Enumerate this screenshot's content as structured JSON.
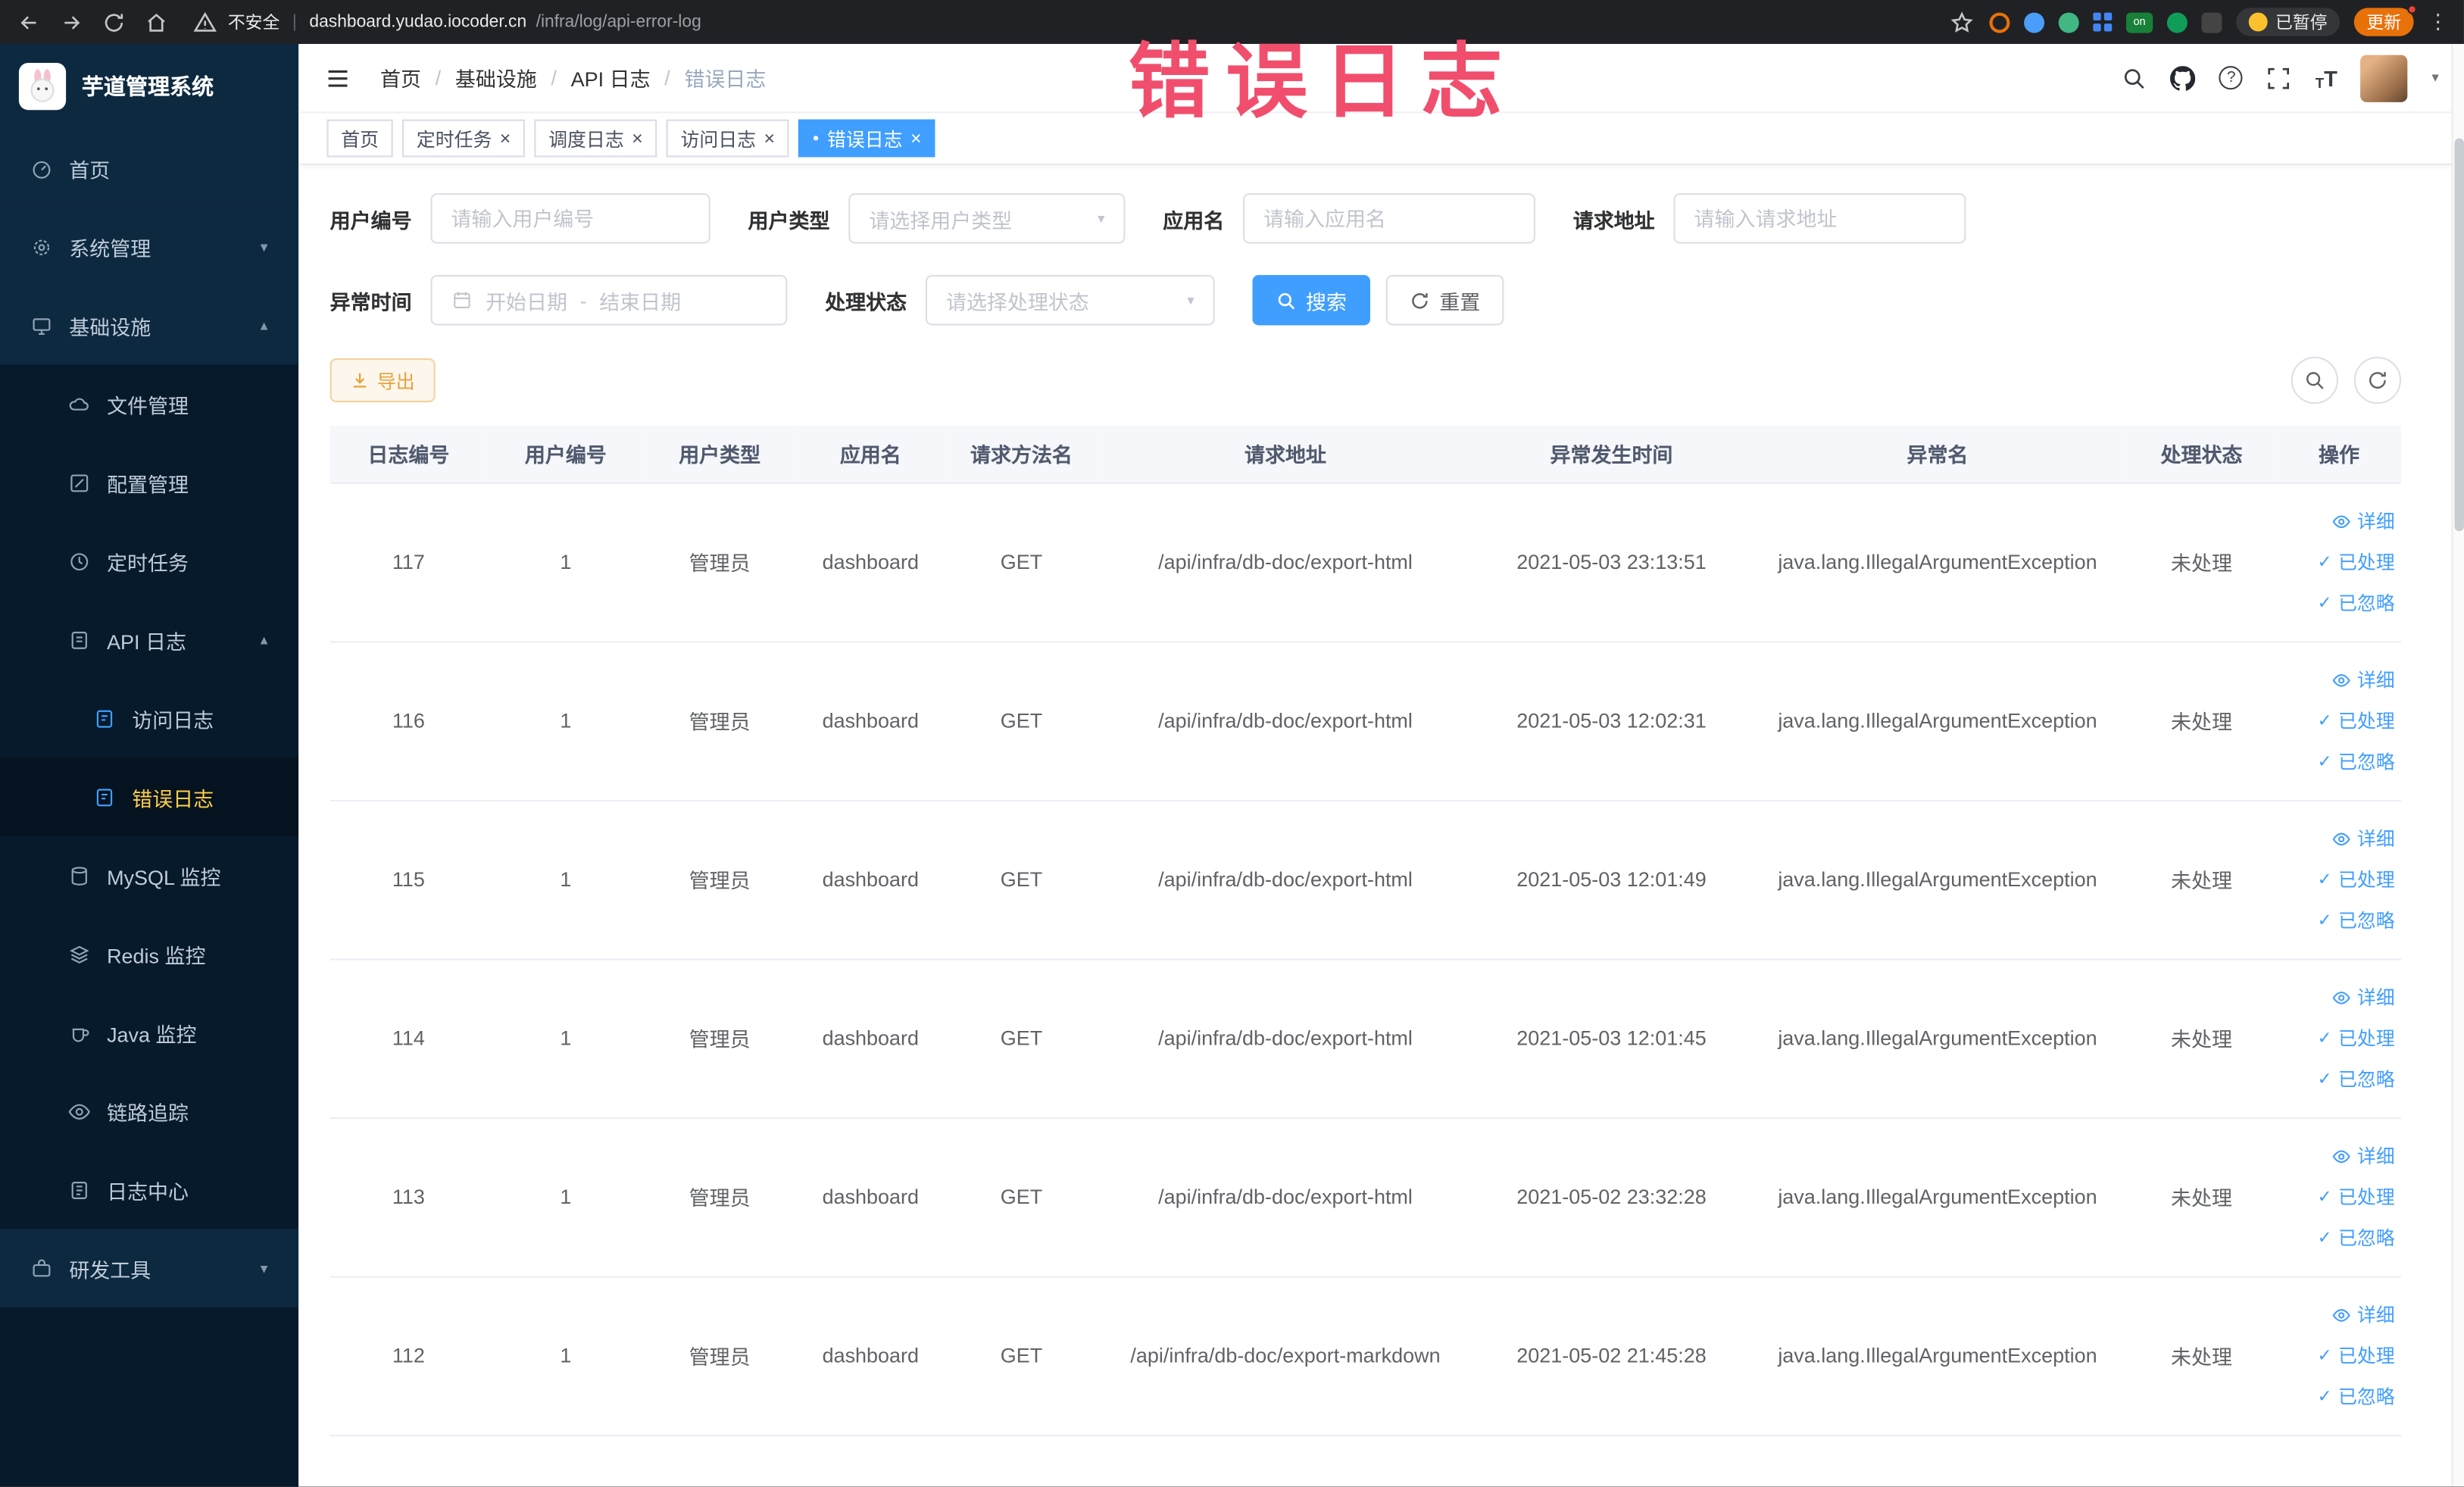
{
  "browser": {
    "security_label": "不安全",
    "url_host": "dashboard.yudao.iocoder.cn",
    "url_path": "/infra/log/api-error-log",
    "extension_on_label": "on",
    "paused_label": "已暂停",
    "update_label": "更新"
  },
  "annotation_text": "错误日志",
  "icons": {
    "check": "✓",
    "close": "×",
    "dot": "●",
    "chevron_down": "▼",
    "chevron_up": "▲",
    "caret_down": "▾",
    "kebab": "⋮",
    "slash": "/",
    "range_separator": "-",
    "question": "?",
    "font_size_large": "T",
    "font_size_small": "T"
  },
  "sidebar": {
    "title": "芋道管理系统",
    "items": [
      {
        "label": "首页"
      },
      {
        "label": "系统管理"
      },
      {
        "label": "基础设施"
      },
      {
        "label": "文件管理"
      },
      {
        "label": "配置管理"
      },
      {
        "label": "定时任务"
      },
      {
        "label": "API 日志"
      },
      {
        "label": "访问日志"
      },
      {
        "label": "错误日志"
      },
      {
        "label": "MySQL 监控"
      },
      {
        "label": "Redis 监控"
      },
      {
        "label": "Java 监控"
      },
      {
        "label": "链路追踪"
      },
      {
        "label": "日志中心"
      },
      {
        "label": "研发工具"
      }
    ]
  },
  "breadcrumb": {
    "items": [
      "首页",
      "基础设施",
      "API 日志",
      "错误日志"
    ]
  },
  "tabs": [
    {
      "label": "首页"
    },
    {
      "label": "定时任务"
    },
    {
      "label": "调度日志"
    },
    {
      "label": "访问日志"
    },
    {
      "label": "错误日志"
    }
  ],
  "filters": {
    "user_id_label": "用户编号",
    "user_id_placeholder": "请输入用户编号",
    "user_type_label": "用户类型",
    "user_type_placeholder": "请选择用户类型",
    "app_name_label": "应用名",
    "app_name_placeholder": "请输入应用名",
    "request_url_label": "请求地址",
    "request_url_placeholder": "请输入请求地址",
    "exception_time_label": "异常时间",
    "start_date_placeholder": "开始日期",
    "end_date_placeholder": "结束日期",
    "process_status_label": "处理状态",
    "process_status_placeholder": "请选择处理状态",
    "search_button": "搜索",
    "reset_button": "重置"
  },
  "toolbar": {
    "export_button": "导出"
  },
  "table": {
    "columns": [
      "日志编号",
      "用户编号",
      "用户类型",
      "应用名",
      "请求方法名",
      "请求地址",
      "异常发生时间",
      "异常名",
      "处理状态",
      "操作"
    ],
    "actions": {
      "detail": "详细",
      "processed": "已处理",
      "ignored": "已忽略"
    },
    "rows": [
      {
        "id": "117",
        "user_id": "1",
        "user_type": "管理员",
        "app": "dashboard",
        "method": "GET",
        "url": "/api/infra/db-doc/export-html",
        "time": "2021-05-03 23:13:51",
        "exception": "java.lang.IllegalArgumentException",
        "status": "未处理"
      },
      {
        "id": "116",
        "user_id": "1",
        "user_type": "管理员",
        "app": "dashboard",
        "method": "GET",
        "url": "/api/infra/db-doc/export-html",
        "time": "2021-05-03 12:02:31",
        "exception": "java.lang.IllegalArgumentException",
        "status": "未处理"
      },
      {
        "id": "115",
        "user_id": "1",
        "user_type": "管理员",
        "app": "dashboard",
        "method": "GET",
        "url": "/api/infra/db-doc/export-html",
        "time": "2021-05-03 12:01:49",
        "exception": "java.lang.IllegalArgumentException",
        "status": "未处理"
      },
      {
        "id": "114",
        "user_id": "1",
        "user_type": "管理员",
        "app": "dashboard",
        "method": "GET",
        "url": "/api/infra/db-doc/export-html",
        "time": "2021-05-03 12:01:45",
        "exception": "java.lang.IllegalArgumentException",
        "status": "未处理"
      },
      {
        "id": "113",
        "user_id": "1",
        "user_type": "管理员",
        "app": "dashboard",
        "method": "GET",
        "url": "/api/infra/db-doc/export-html",
        "time": "2021-05-02 23:32:28",
        "exception": "java.lang.IllegalArgumentException",
        "status": "未处理"
      },
      {
        "id": "112",
        "user_id": "1",
        "user_type": "管理员",
        "app": "dashboard",
        "method": "GET",
        "url": "/api/infra/db-doc/export-markdown",
        "time": "2021-05-02 21:45:28",
        "exception": "java.lang.IllegalArgumentException",
        "status": "未处理"
      }
    ]
  },
  "colors": {
    "accent": "#409eff",
    "active_menu_text": "#ffd04b",
    "annotation": "#f14e6d",
    "export_warning": "#e6a23c",
    "sidebar_bg": "#071a2c"
  }
}
